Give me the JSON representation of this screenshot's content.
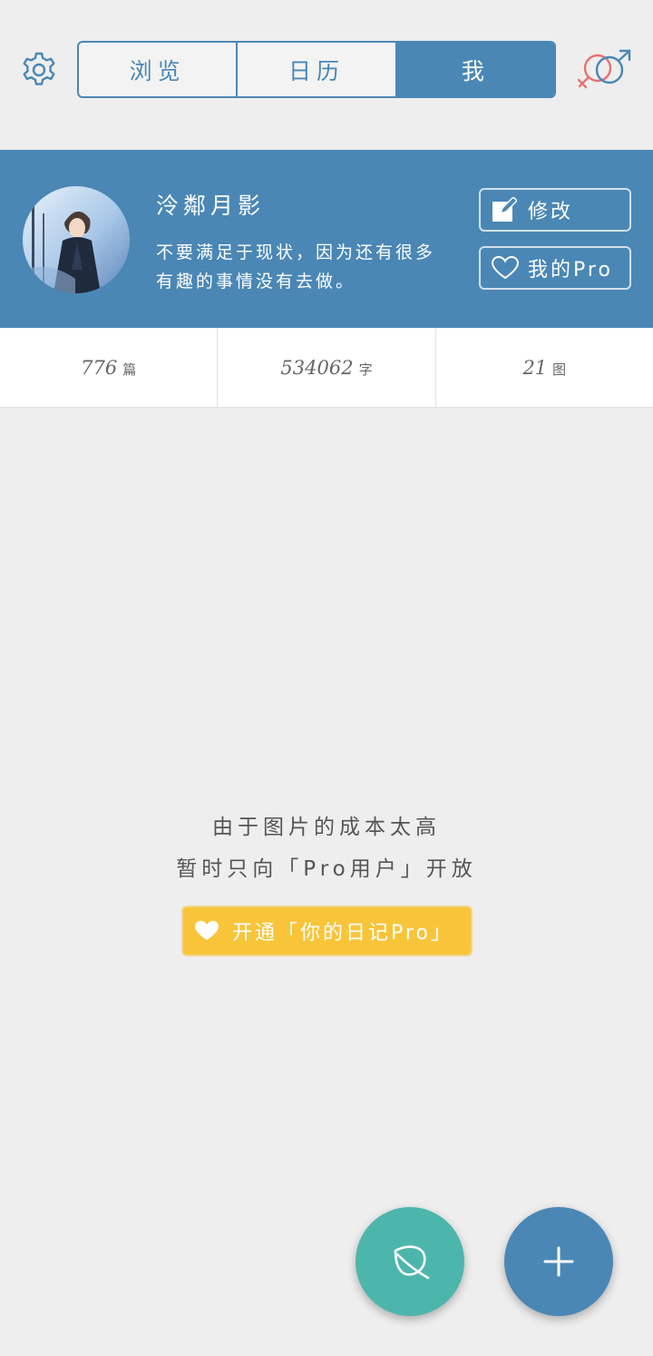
{
  "colors": {
    "accent": "#4a87b5",
    "background": "#eeeeee",
    "pro_yellow": "#f8c53a",
    "leaf_fab": "#4db6ac",
    "gender_female": "#e57373",
    "gender_male": "#4a87b5"
  },
  "header": {
    "settings_icon": "gear-icon",
    "tabs": [
      {
        "label": "浏览",
        "active": false
      },
      {
        "label": "日历",
        "active": false
      },
      {
        "label": "我",
        "active": true
      }
    ],
    "gender_icon": "gender-symbol-icon"
  },
  "profile": {
    "avatar_icon": "avatar",
    "name": "泠鄰月影",
    "motto": "不要满足于现状，因为还有很多有趣的事情没有去做。",
    "edit_button": {
      "icon": "edit-icon",
      "label": "修改"
    },
    "pro_button": {
      "icon": "heart-outline-icon",
      "label": "我的Pro"
    }
  },
  "stats": [
    {
      "value": "776",
      "unit": "篇"
    },
    {
      "value": "534062",
      "unit": "字"
    },
    {
      "value": "21",
      "unit": "图"
    }
  ],
  "notice": {
    "line1": "由于图片的成本太高",
    "line2": "暂时只向「Pro用户」开放",
    "cta_icon": "heart-icon",
    "cta_label": "开通「你的日记Pro」"
  },
  "fabs": {
    "leaf_icon": "leaf-icon",
    "add_icon": "plus-icon"
  }
}
